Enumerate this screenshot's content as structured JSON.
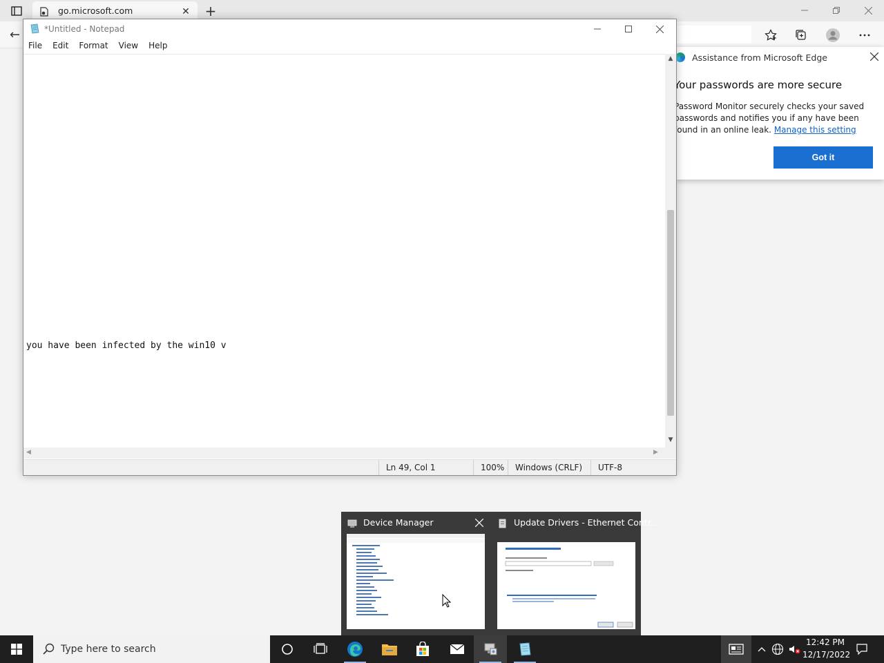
{
  "edge": {
    "tab_title": "go.microsoft.com",
    "tab_close": "✕",
    "new_tab": "+",
    "back_icon": "←",
    "popup": {
      "header": "Assistance from Microsoft Edge",
      "title": "Your passwords are more secure",
      "body": "Password Monitor securely checks your saved passwords and notifies you if any have been found in an online leak.",
      "link": "Manage this setting",
      "button": "Got it"
    }
  },
  "notepad": {
    "title": "*Untitled - Notepad",
    "menu": [
      "File",
      "Edit",
      "Format",
      "View",
      "Help"
    ],
    "text": "you have been infected by the win10 v",
    "status": {
      "position": "Ln 49, Col 1",
      "zoom": "100%",
      "line_ending": "Windows (CRLF)",
      "encoding": "UTF-8"
    }
  },
  "thumbnails": [
    {
      "title": "Device Manager"
    },
    {
      "title": "Update Drivers - Ethernet Contr..."
    }
  ],
  "taskbar": {
    "search_placeholder": "Type here to search",
    "time": "12:42 PM",
    "date": "12/17/2022"
  }
}
